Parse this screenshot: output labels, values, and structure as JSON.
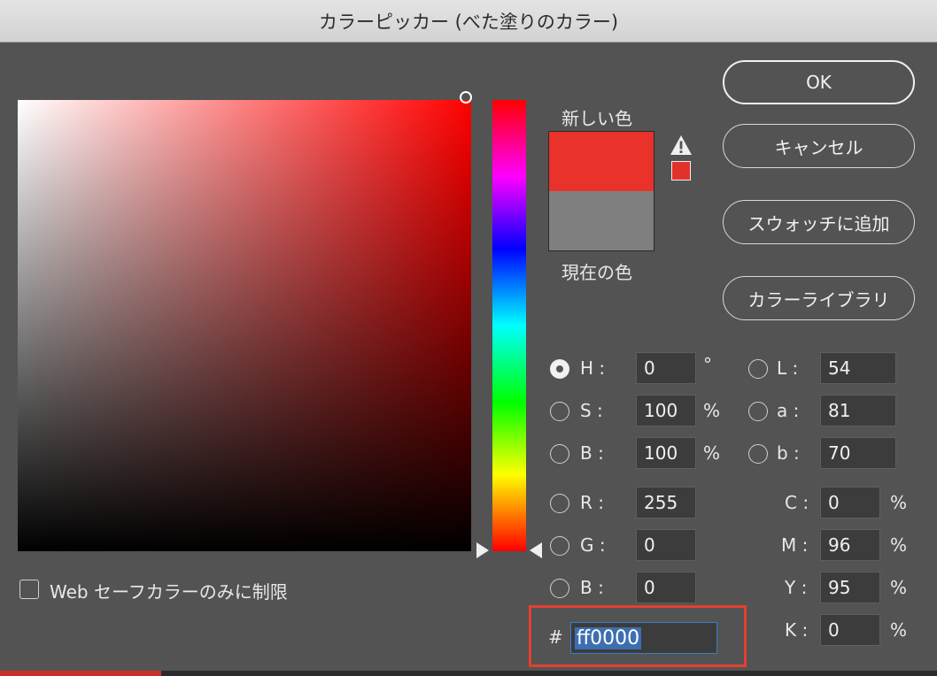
{
  "window": {
    "title": "カラーピッカー (べた塗りのカラー)"
  },
  "preview": {
    "new_label": "新しい色",
    "current_label": "現在の色",
    "new_color": "#e8322a",
    "current_color": "#7f7f7f"
  },
  "colors": {
    "hue": "#ff0000",
    "highlight": "#e4402d",
    "selection": "#3d6fb0"
  },
  "buttons": {
    "ok": "OK",
    "cancel": "キャンセル",
    "add_swatch": "スウォッチに追加",
    "color_library": "カラーライブラリ"
  },
  "hsb": {
    "h": {
      "label": "H :",
      "value": "0",
      "unit": "°"
    },
    "s": {
      "label": "S :",
      "value": "100",
      "unit": "%"
    },
    "b": {
      "label": "B :",
      "value": "100",
      "unit": "%"
    }
  },
  "lab": {
    "l": {
      "label": "L :",
      "value": "54"
    },
    "a": {
      "label": "a :",
      "value": "81"
    },
    "b": {
      "label": "b :",
      "value": "70"
    }
  },
  "rgb": {
    "r": {
      "label": "R :",
      "value": "255"
    },
    "g": {
      "label": "G :",
      "value": "0"
    },
    "b": {
      "label": "B :",
      "value": "0"
    }
  },
  "cmyk": {
    "c": {
      "label": "C :",
      "value": "0",
      "unit": "%"
    },
    "m": {
      "label": "M :",
      "value": "96",
      "unit": "%"
    },
    "y": {
      "label": "Y :",
      "value": "95",
      "unit": "%"
    },
    "k": {
      "label": "K :",
      "value": "0",
      "unit": "%"
    }
  },
  "hex": {
    "label": "#",
    "value": "ff0000"
  },
  "web_safe": {
    "label": "Web セーフカラーのみに制限"
  },
  "icons": {
    "warning": "warning-triangle-icon"
  }
}
